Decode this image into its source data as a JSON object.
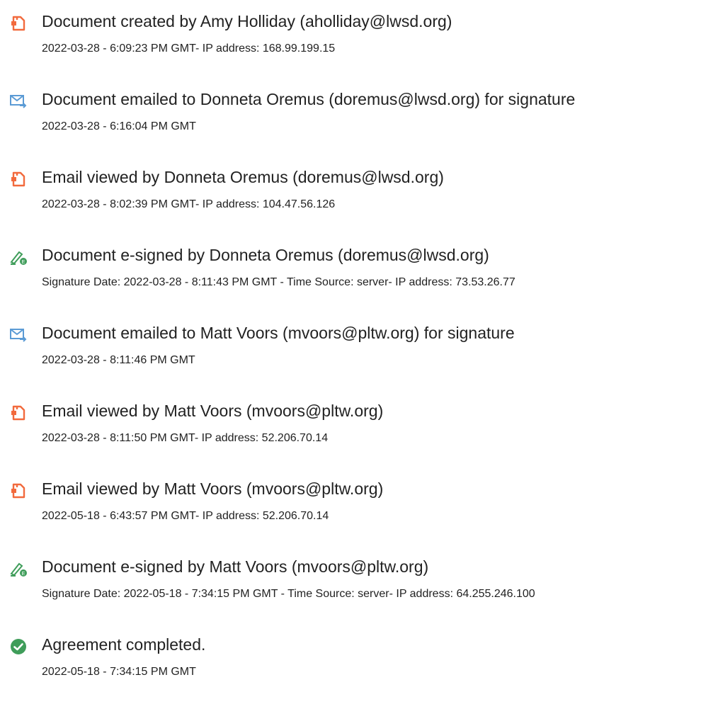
{
  "colors": {
    "doc_icon": "#f26a3d",
    "email_icon": "#5b9bd5",
    "sign_icon_pen": "#3f9d5a",
    "check_icon": "#3f9d5a"
  },
  "events": [
    {
      "icon": "document-icon",
      "title": "Document created by Amy Holliday (aholliday@lwsd.org)",
      "detail": "2022-03-28 - 6:09:23 PM GMT- IP address: 168.99.199.15"
    },
    {
      "icon": "email-sent-icon",
      "title": "Document emailed to Donneta Oremus (doremus@lwsd.org) for signature",
      "detail": "2022-03-28 - 6:16:04 PM GMT"
    },
    {
      "icon": "document-icon",
      "title": "Email viewed by Donneta Oremus (doremus@lwsd.org)",
      "detail": "2022-03-28 - 8:02:39 PM GMT- IP address: 104.47.56.126"
    },
    {
      "icon": "e-sign-pen-icon",
      "title": "Document e-signed by Donneta Oremus (doremus@lwsd.org)",
      "detail": "Signature Date: 2022-03-28 - 8:11:43 PM GMT - Time Source: server- IP address: 73.53.26.77"
    },
    {
      "icon": "email-sent-icon",
      "title": "Document emailed to Matt Voors (mvoors@pltw.org) for signature",
      "detail": "2022-03-28 - 8:11:46 PM GMT"
    },
    {
      "icon": "document-icon",
      "title": "Email viewed by Matt Voors (mvoors@pltw.org)",
      "detail": "2022-03-28 - 8:11:50 PM GMT- IP address: 52.206.70.14"
    },
    {
      "icon": "document-icon",
      "title": "Email viewed by Matt Voors (mvoors@pltw.org)",
      "detail": "2022-05-18 - 6:43:57 PM GMT- IP address: 52.206.70.14"
    },
    {
      "icon": "e-sign-pen-icon",
      "title": "Document e-signed by Matt Voors (mvoors@pltw.org)",
      "detail": "Signature Date: 2022-05-18 - 7:34:15 PM GMT - Time Source: server- IP address: 64.255.246.100"
    },
    {
      "icon": "check-circle-icon",
      "title": "Agreement completed.",
      "detail": "2022-05-18 - 7:34:15 PM GMT"
    }
  ]
}
